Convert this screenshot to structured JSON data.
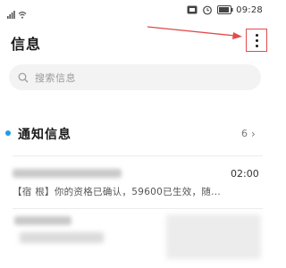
{
  "status_bar": {
    "time": "09:28"
  },
  "header": {
    "title": "信息"
  },
  "search": {
    "placeholder": "搜索信息"
  },
  "notifications": {
    "label": "通知信息",
    "count": "6"
  },
  "messages": [
    {
      "time": "02:00",
      "preview": "【宿 根】你的资格已确认，59600已生效，随..."
    }
  ],
  "colors": {
    "accent_dot": "#1b9fe4",
    "annotation": "#e24b4b"
  }
}
